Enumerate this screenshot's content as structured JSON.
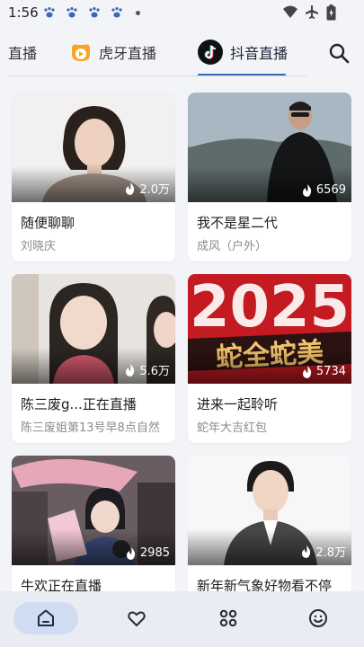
{
  "status_bar": {
    "time": "1:56"
  },
  "tabs": [
    {
      "label": "直播"
    },
    {
      "label": "虎牙直播"
    },
    {
      "label": "抖音直播",
      "active": true
    }
  ],
  "cards": [
    {
      "title": "随便聊聊",
      "subtitle": "刘晓庆",
      "viewers": "2.0万"
    },
    {
      "title": "我不是星二代",
      "subtitle": "成风（户外）",
      "viewers": "6569"
    },
    {
      "title": "陈三废g...正在直播",
      "subtitle": "陈三废姐第13号早8点自然",
      "viewers": "5.6万"
    },
    {
      "title": "进来一起聆听",
      "subtitle": "蛇年大吉红包",
      "viewers": "5734"
    },
    {
      "title": "牛欢正在直播",
      "subtitle": "",
      "viewers": "2985"
    },
    {
      "title": "新年新气象好物看不停",
      "subtitle": "",
      "viewers": "2.8万"
    }
  ],
  "thumb4": {
    "year_text": "2025",
    "banner_text": "蛇全蛇美"
  },
  "colors": {
    "accent": "#3a6ab4",
    "nav_active_bg": "#cfdcf2",
    "background": "#f3f4f8"
  },
  "nav": [
    {
      "icon": "home-icon",
      "active": true
    },
    {
      "icon": "heart-icon"
    },
    {
      "icon": "grid-icon"
    },
    {
      "icon": "smile-icon"
    }
  ]
}
